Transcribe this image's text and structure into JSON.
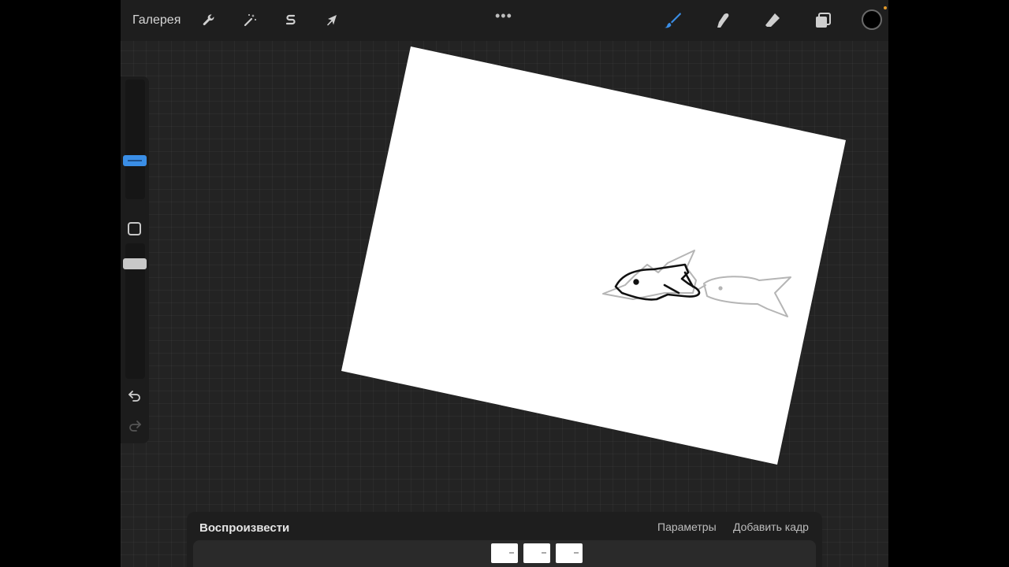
{
  "topbar": {
    "gallery_label": "Галерея",
    "actions_icon": "wrench-icon",
    "adjustments_icon": "magic-wand-icon",
    "selection_icon": "selection-s-icon",
    "transform_icon": "arrow-cursor-icon",
    "more_label": "•••",
    "brush_icon": "brush-icon",
    "smudge_icon": "smudge-finger-icon",
    "eraser_icon": "eraser-icon",
    "layers_icon": "layers-icon",
    "active_color": "#000000",
    "accent_color": "#3a8ee6"
  },
  "sidebar": {
    "brush_size_icon": "size-slider",
    "modify_icon": "square-icon",
    "undo_icon": "undo-icon",
    "redo_icon": "redo-icon"
  },
  "animation": {
    "play_label": "Воспроизвести",
    "settings_label": "Параметры",
    "add_frame_label": "Добавить кадр",
    "frames": [
      {
        "name": "frame-1"
      },
      {
        "name": "frame-2"
      },
      {
        "name": "frame-3"
      }
    ]
  }
}
